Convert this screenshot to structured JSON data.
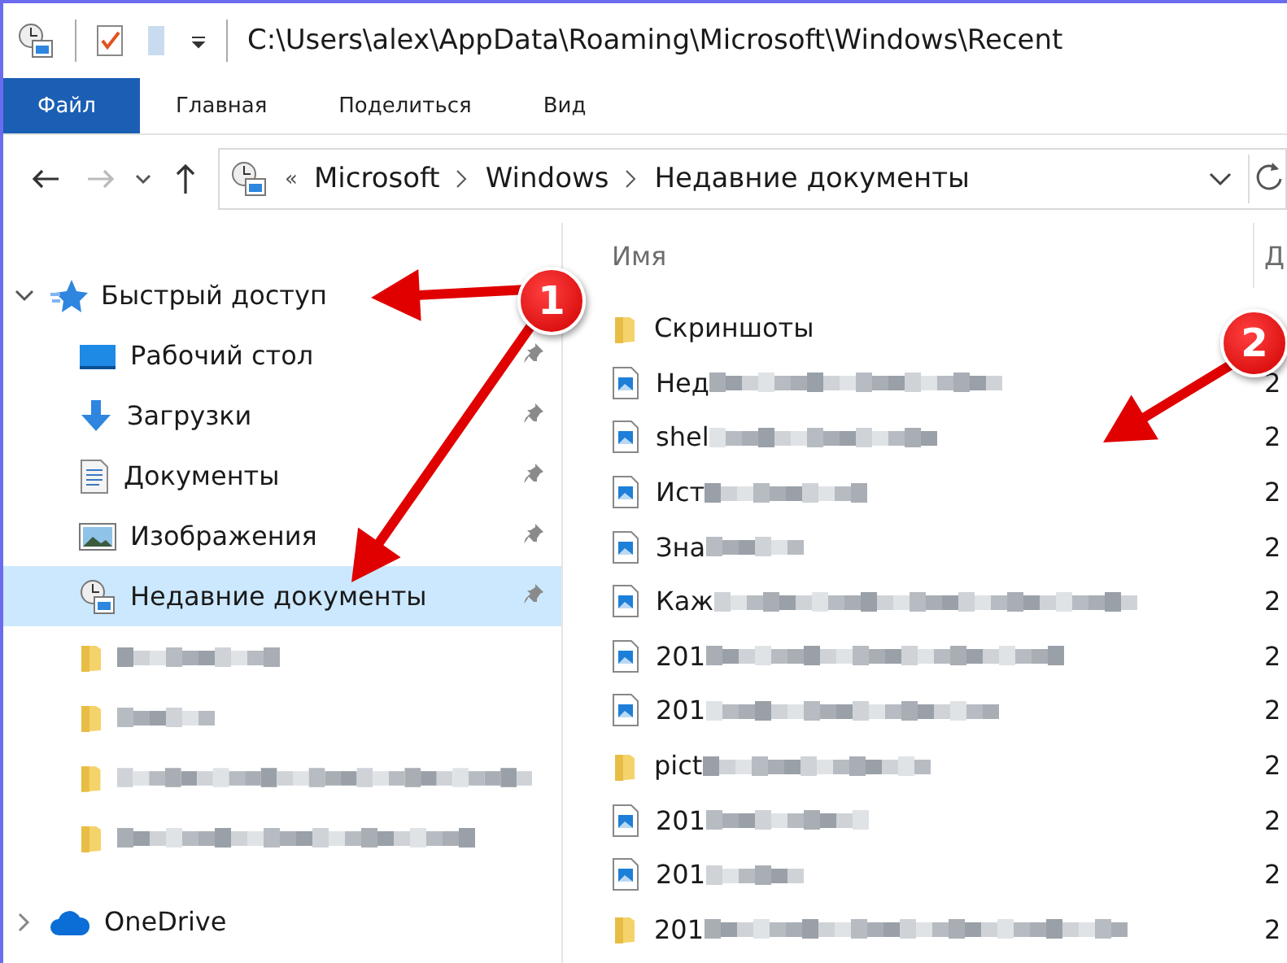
{
  "window": {
    "path": "C:\\Users\\alex\\AppData\\Roaming\\Microsoft\\Windows\\Recent"
  },
  "ribbon_tabs": [
    {
      "label": "Файл",
      "kind": "file"
    },
    {
      "label": "Главная",
      "kind": "tab"
    },
    {
      "label": "Поделиться",
      "kind": "tab"
    },
    {
      "label": "Вид",
      "kind": "tab"
    }
  ],
  "address_bar": {
    "prefix": "«",
    "crumbs": [
      "Microsoft",
      "Windows",
      "Недавние документы"
    ]
  },
  "sidebar": {
    "items": [
      {
        "label": "Быстрый доступ",
        "kind": "star",
        "expanded": true,
        "children": [
          {
            "label": "Рабочий стол",
            "kind": "desktop",
            "blurred": false,
            "pinned": true,
            "selected": false
          },
          {
            "label": "Загрузки",
            "kind": "download",
            "blurred": false,
            "pinned": true,
            "selected": false
          },
          {
            "label": "Документы",
            "kind": "document",
            "blurred": false,
            "pinned": true,
            "selected": false
          },
          {
            "label": "Изображения",
            "kind": "pictures",
            "blurred": false,
            "pinned": true,
            "selected": false
          },
          {
            "label": "Недавние документы",
            "kind": "recent",
            "blurred": false,
            "pinned": true,
            "selected": true
          },
          {
            "kind": "folder",
            "blurred": true,
            "pinned": false,
            "selected": false
          },
          {
            "kind": "folder",
            "blurred": true,
            "pinned": false,
            "selected": false
          },
          {
            "kind": "folder",
            "blurred": true,
            "pinned": false,
            "selected": false
          },
          {
            "kind": "folder",
            "blurred": true,
            "pinned": false,
            "selected": false
          }
        ]
      },
      {
        "label": "OneDrive",
        "kind": "cloud",
        "expanded": false
      }
    ]
  },
  "file_list": {
    "columns": [
      "Имя",
      "Д"
    ],
    "rows": [
      {
        "kind": "folder",
        "name": "Скриншоты",
        "blurred": false
      },
      {
        "kind": "image",
        "name": "Нед",
        "blurred": true,
        "date": "2"
      },
      {
        "kind": "image",
        "name": "shel",
        "blurred": true,
        "date": "2"
      },
      {
        "kind": "image",
        "name": "Ист",
        "blurred": true,
        "date": "2"
      },
      {
        "kind": "image",
        "name": "Зна",
        "blurred": true,
        "date": "2"
      },
      {
        "kind": "image",
        "name": "Каж",
        "blurred": true,
        "date": "2"
      },
      {
        "kind": "image",
        "name": "201",
        "blurred": true,
        "date": "2"
      },
      {
        "kind": "image",
        "name": "201",
        "blurred": true,
        "date": "2"
      },
      {
        "kind": "folder",
        "name": "pict",
        "blurred": true,
        "date": "2"
      },
      {
        "kind": "image",
        "name": "201",
        "blurred": true,
        "date": "2"
      },
      {
        "kind": "image",
        "name": "201",
        "blurred": true,
        "date": "2"
      },
      {
        "kind": "folder",
        "name": "201",
        "blurred": true,
        "date": "2"
      }
    ]
  },
  "annotations": [
    {
      "label": "1"
    },
    {
      "label": "2"
    }
  ]
}
